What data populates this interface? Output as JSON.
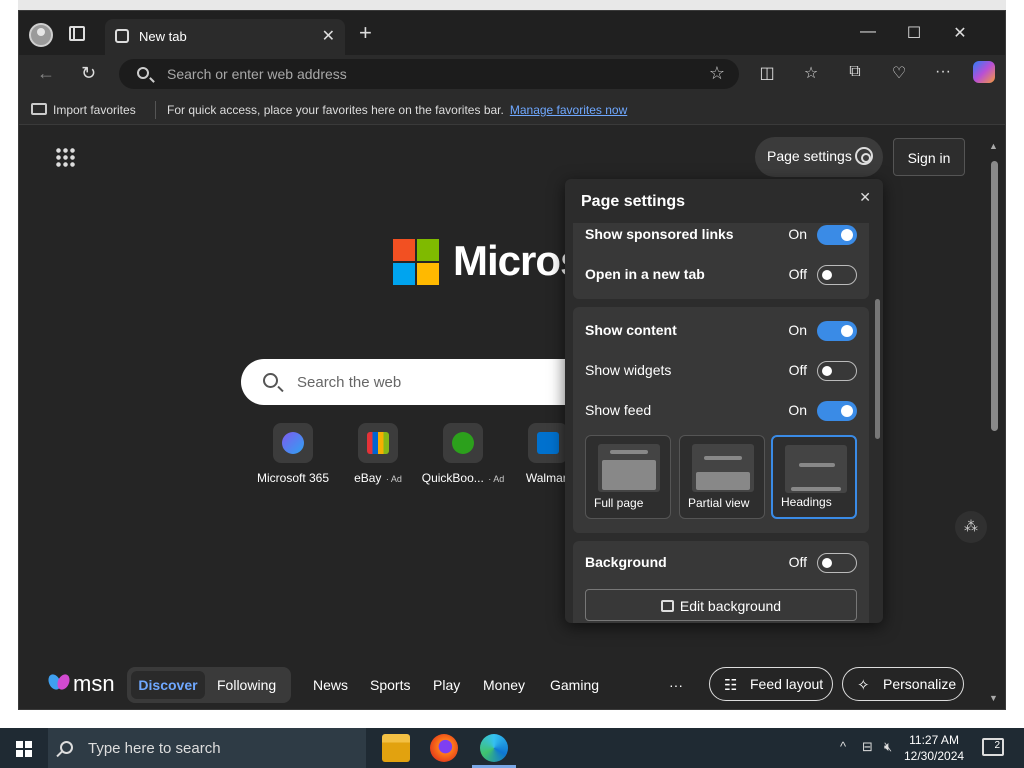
{
  "browser": {
    "tab_title": "New tab",
    "address_placeholder": "Search or enter web address",
    "favorites_import": "Import favorites",
    "favorites_message": "For quick access, place your favorites here on the favorites bar.",
    "favorites_link": "Manage favorites now"
  },
  "page": {
    "page_settings_label": "Page settings",
    "sign_in_label": "Sign in",
    "brand_word": "Micros",
    "search_placeholder": "Search the web",
    "quick_links": [
      {
        "label": "Microsoft 365",
        "ad": ""
      },
      {
        "label": "eBay",
        "ad": "· Ad"
      },
      {
        "label": "QuickBoo...",
        "ad": "· Ad"
      },
      {
        "label": "Walmart",
        "ad": ""
      }
    ]
  },
  "panel": {
    "title": "Page settings",
    "close": "✕",
    "rows": [
      {
        "label": "Show sponsored links",
        "state": "On"
      },
      {
        "label": "Open in a new tab",
        "state": "Off"
      },
      {
        "label": "Show content",
        "state": "On"
      },
      {
        "label": "Show widgets",
        "state": "Off"
      },
      {
        "label": "Show feed",
        "state": "On"
      },
      {
        "label": "Background",
        "state": "Off"
      }
    ],
    "layouts": [
      {
        "label": "Full page",
        "selected": false
      },
      {
        "label": "Partial view",
        "selected": false
      },
      {
        "label": "Headings",
        "selected": true
      }
    ],
    "edit_background": "Edit background"
  },
  "msn": {
    "logo": "msn",
    "segments": [
      "Discover",
      "Following"
    ],
    "nav": [
      "News",
      "Sports",
      "Play",
      "Money",
      "Gaming",
      "···"
    ],
    "feed_layout": "Feed layout",
    "personalize": "Personalize"
  },
  "taskbar": {
    "search_placeholder": "Type here to search",
    "time": "11:27 AM",
    "date": "12/30/2024",
    "notification_count": "2"
  },
  "colors": {
    "accent": "#3a8be6",
    "link": "#6fa8ff"
  }
}
